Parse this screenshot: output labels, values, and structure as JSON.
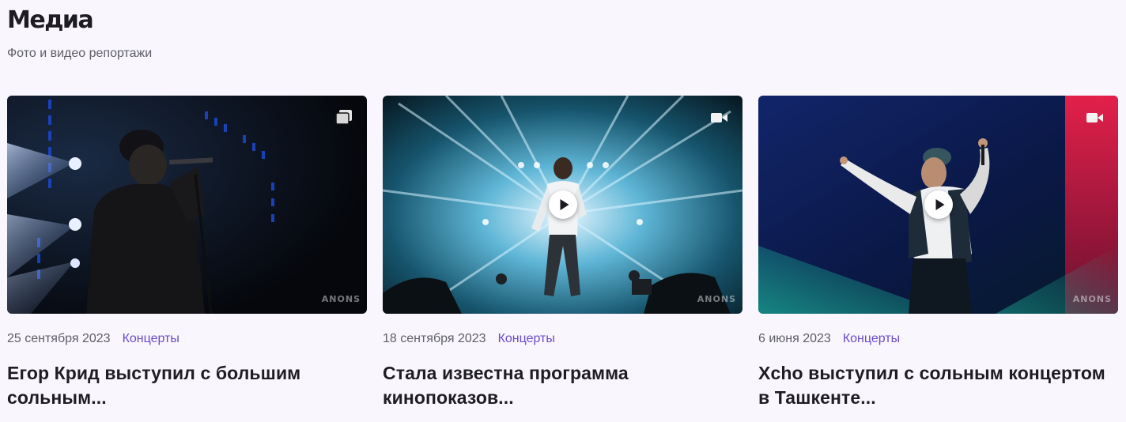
{
  "section": {
    "title": "Медиа",
    "subtitle": "Фото и видео репортажи"
  },
  "cards": [
    {
      "date": "25 сентября 2023",
      "category": "Концерты",
      "title": "Егор Крид выступил с большим сольным...",
      "media_type": "gallery-icon",
      "has_play": false,
      "watermark": "ANONS"
    },
    {
      "date": "18 сентября 2023",
      "category": "Концерты",
      "title": "Стала известна программа кинопоказов...",
      "media_type": "video-camera-icon",
      "has_play": true,
      "watermark": "ANONS"
    },
    {
      "date": "6 июня 2023",
      "category": "Концерты",
      "title": "Xcho выступил с сольным концертом в Ташкенте...",
      "media_type": "video-camera-icon",
      "has_play": true,
      "watermark": "ANONS"
    }
  ],
  "colors": {
    "background": "#f9f6fd",
    "category": "#6a4cc9",
    "meta": "#5f5f66",
    "title": "#1e1e22"
  }
}
